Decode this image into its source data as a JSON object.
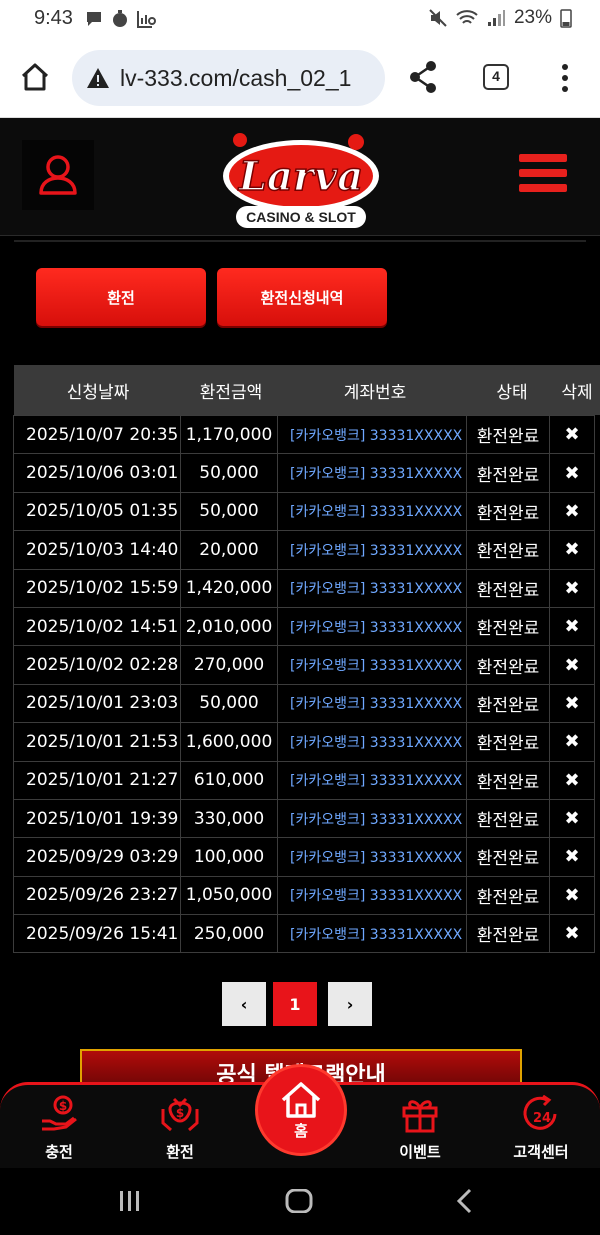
{
  "status_bar": {
    "time": "9:43",
    "battery": "23%"
  },
  "browser": {
    "url": "lv-333.com/cash_02_1",
    "tab_count": "4"
  },
  "site": {
    "logo_text": "Larva",
    "logo_subtext": "CASINO & SLOT"
  },
  "actions": {
    "exchange_label": "환전",
    "history_label": "환전신청내역"
  },
  "table": {
    "headers": [
      "신청날짜",
      "환전금액",
      "계좌번호",
      "상태",
      "삭제"
    ],
    "rows": [
      {
        "date": "2025/10/07 20:35",
        "amount": "1,170,000",
        "account": "[카카오뱅크] 33331XXXXX",
        "status": "환전완료",
        "delete": "✖"
      },
      {
        "date": "2025/10/06 03:01",
        "amount": "50,000",
        "account": "[카카오뱅크] 33331XXXXX",
        "status": "환전완료",
        "delete": "✖"
      },
      {
        "date": "2025/10/05 01:35",
        "amount": "50,000",
        "account": "[카카오뱅크] 33331XXXXX",
        "status": "환전완료",
        "delete": "✖"
      },
      {
        "date": "2025/10/03 14:40",
        "amount": "20,000",
        "account": "[카카오뱅크] 33331XXXXX",
        "status": "환전완료",
        "delete": "✖"
      },
      {
        "date": "2025/10/02 15:59",
        "amount": "1,420,000",
        "account": "[카카오뱅크] 33331XXXXX",
        "status": "환전완료",
        "delete": "✖"
      },
      {
        "date": "2025/10/02 14:51",
        "amount": "2,010,000",
        "account": "[카카오뱅크] 33331XXXXX",
        "status": "환전완료",
        "delete": "✖"
      },
      {
        "date": "2025/10/02 02:28",
        "amount": "270,000",
        "account": "[카카오뱅크] 33331XXXXX",
        "status": "환전완료",
        "delete": "✖"
      },
      {
        "date": "2025/10/01 23:03",
        "amount": "50,000",
        "account": "[카카오뱅크] 33331XXXXX",
        "status": "환전완료",
        "delete": "✖"
      },
      {
        "date": "2025/10/01 21:53",
        "amount": "1,600,000",
        "account": "[카카오뱅크] 33331XXXXX",
        "status": "환전완료",
        "delete": "✖"
      },
      {
        "date": "2025/10/01 21:27",
        "amount": "610,000",
        "account": "[카카오뱅크] 33331XXXXX",
        "status": "환전완료",
        "delete": "✖"
      },
      {
        "date": "2025/10/01 19:39",
        "amount": "330,000",
        "account": "[카카오뱅크] 33331XXXXX",
        "status": "환전완료",
        "delete": "✖"
      },
      {
        "date": "2025/09/29 03:29",
        "amount": "100,000",
        "account": "[카카오뱅크] 33331XXXXX",
        "status": "환전완료",
        "delete": "✖"
      },
      {
        "date": "2025/09/26 23:27",
        "amount": "1,050,000",
        "account": "[카카오뱅크] 33331XXXXX",
        "status": "환전완료",
        "delete": "✖"
      },
      {
        "date": "2025/09/26 15:41",
        "amount": "250,000",
        "account": "[카카오뱅크] 33331XXXXX",
        "status": "환전완료",
        "delete": "✖"
      }
    ]
  },
  "pagination": {
    "prev": "‹",
    "current": "1",
    "next": "›"
  },
  "notice": {
    "text": "공식 텔레그램안내"
  },
  "bottom_nav": {
    "charge": "충전",
    "exchange": "환전",
    "home": "홈",
    "event": "이벤트",
    "support": "고객센터"
  },
  "colors": {
    "accent_red": "#e8141a",
    "link_blue": "#6fa8ff"
  }
}
